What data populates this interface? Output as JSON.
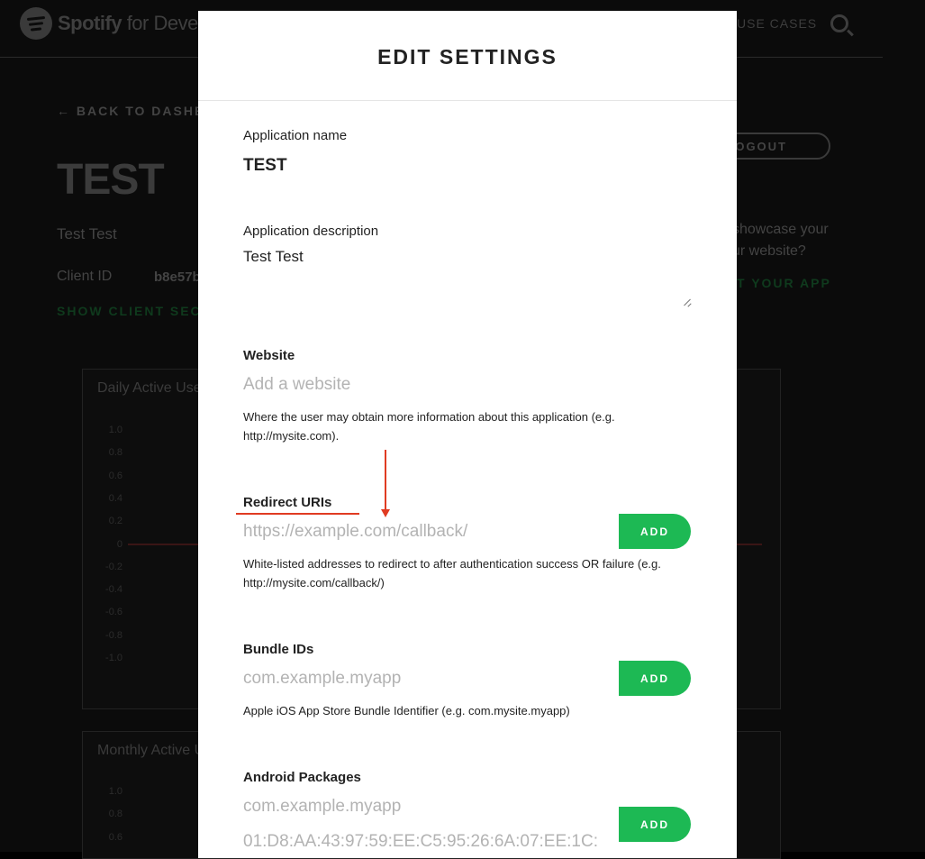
{
  "background": {
    "logo_brand": "Spotify",
    "logo_suffix": "for Devel",
    "nav_use_cases": "USE CASES",
    "back_link": "← BACK TO DASHB",
    "app_title": "TEST",
    "app_description": "Test Test",
    "client_id_label": "Client ID",
    "client_id_value": "b8e57b",
    "show_secret": "SHOW CLIENT SEC",
    "logout": "LOGOUT",
    "showcase_line1": "showcase your",
    "showcase_line2": "ur website?",
    "submit_app": "T YOUR APP",
    "daily_chart_title": "Daily Active Use",
    "monthly_chart_title": "Monthly Active U",
    "daily_ticks": [
      "1.0",
      "0.8",
      "0.6",
      "0.4",
      "0.2",
      "0",
      "-0.2",
      "-0.4",
      "-0.6",
      "-0.8",
      "-1.0"
    ],
    "monthly_ticks": [
      "1.0",
      "0.8",
      "0.6"
    ]
  },
  "modal": {
    "title": "EDIT SETTINGS",
    "app_name_label": "Application name",
    "app_name_value": "TEST",
    "app_desc_label": "Application description",
    "app_desc_value": "Test Test",
    "website_label": "Website",
    "website_placeholder": "Add a website",
    "website_help": "Where the user may obtain more information about this application (e.g. http://mysite.com).",
    "redirect_label": "Redirect URIs",
    "redirect_placeholder": "https://example.com/callback/",
    "redirect_help": "White-listed addresses to redirect to after authentication success OR failure (e.g. http://mysite.com/callback/)",
    "bundle_label": "Bundle IDs",
    "bundle_placeholder": "com.example.myapp",
    "bundle_help": "Apple iOS App Store Bundle Identifier (e.g. com.mysite.myapp)",
    "android_label": "Android Packages",
    "android_package_placeholder": "com.example.myapp",
    "android_fingerprint_placeholder": "01:D8:AA:43:97:59:EE:C5:95:26:6A:07:EE:1C:",
    "add_label": "ADD"
  },
  "colors": {
    "accent": "#1db954",
    "annotation": "#e03b22"
  }
}
